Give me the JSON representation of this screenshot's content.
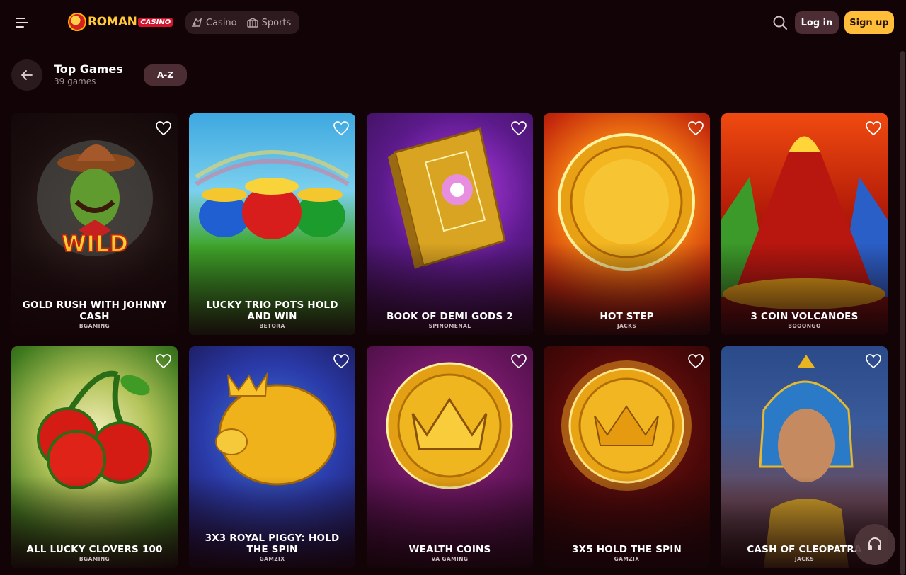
{
  "header": {
    "logo_text": "ROMAN",
    "logo_sub": "CASINO",
    "nav": [
      {
        "label": "Casino",
        "icon": "casino-icon"
      },
      {
        "label": "Sports",
        "icon": "sports-icon"
      }
    ],
    "login_label": "Log in",
    "signup_label": "Sign up"
  },
  "section": {
    "title": "Top Games",
    "count": "39 games",
    "sort_label": "A-Z"
  },
  "games": [
    {
      "title": "GOLD RUSH WITH JOHNNY CASH",
      "provider": "BGAMING"
    },
    {
      "title": "LUCKY TRIO POTS HOLD AND WIN",
      "provider": "BETORA"
    },
    {
      "title": "BOOK OF DEMI GODS 2",
      "provider": "SPINOMENAL"
    },
    {
      "title": "HOT STEP",
      "provider": "JACKS"
    },
    {
      "title": "3 COIN VOLCANOES",
      "provider": "BOOONGO"
    },
    {
      "title": "ALL LUCKY CLOVERS 100",
      "provider": "BGAMING"
    },
    {
      "title": "3X3 ROYAL PIGGY: HOLD THE SPIN",
      "provider": "GAMZIX"
    },
    {
      "title": "WEALTH COINS",
      "provider": "VA GAMING"
    },
    {
      "title": "3X5 HOLD THE SPIN",
      "provider": "GAMZIX"
    },
    {
      "title": "CASH OF CLEOPATRA",
      "provider": "JACKS"
    }
  ],
  "colors": {
    "background": "#120406",
    "accent": "#ffbd3a",
    "button_dark": "#4b2d33"
  }
}
